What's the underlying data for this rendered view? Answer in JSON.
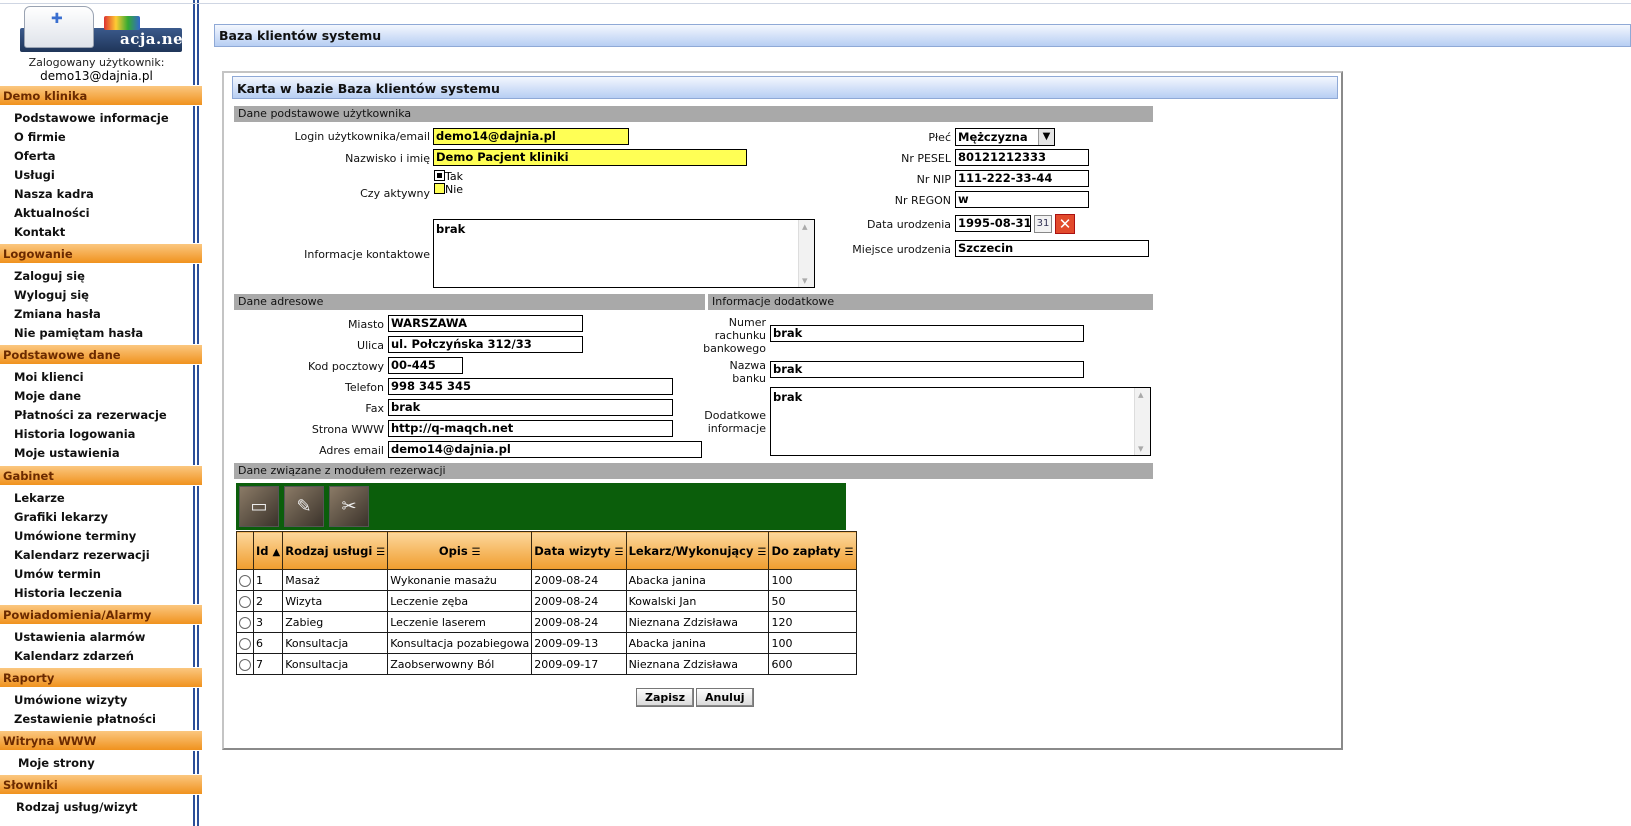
{
  "sidebar": {
    "logo_text": "acja.net",
    "user_label": "Zalogowany użytkownik:",
    "user_email": "demo13@dajnia.pl",
    "sections": [
      {
        "title": "Demo klinika",
        "items": [
          "Podstawowe informacje",
          "O firmie",
          "Oferta",
          "Usługi",
          "Nasza kadra",
          "Aktualności",
          "Kontakt"
        ]
      },
      {
        "title": "Logowanie",
        "items": [
          "Zaloguj się",
          "Wyloguj się",
          "Zmiana hasła",
          "Nie pamiętam hasła"
        ]
      },
      {
        "title": "Podstawowe dane",
        "items": [
          "Moi klienci",
          "Moje dane",
          "Płatności za rezerwacje",
          "Historia logowania",
          "Moje ustawienia"
        ]
      },
      {
        "title": "Gabinet",
        "items": [
          "Lekarze",
          "Grafiki lekarzy",
          "Umówione terminy",
          "Kalendarz rezerwacji",
          "Umów termin",
          "Historia leczenia"
        ]
      },
      {
        "title": "Powiadomienia/Alarmy",
        "items": [
          "Ustawienia alarmów",
          "Kalendarz zdarzeń"
        ]
      },
      {
        "title": "Raporty",
        "items": [
          "Umówione wizyty",
          "Zestawienie płatności"
        ]
      },
      {
        "title": "Witryna WWW",
        "items": [
          "Moje strony"
        ]
      },
      {
        "title": "Słowniki",
        "items": [
          "Rodzaj usług/wizyt"
        ]
      }
    ]
  },
  "main": {
    "title": "Baza klientów systemu",
    "card_title": "Karta w bazie Baza klientów systemu"
  },
  "basic": {
    "section_title": "Dane podstawowe użytkownika",
    "login_label": "Login użytkownika/email",
    "login_value": "demo14@dajnia.pl",
    "name_label": "Nazwisko i imię",
    "name_value": "Demo Pacjent kliniki",
    "active_label": "Czy aktywny",
    "active_yes": "Tak",
    "active_no": "Nie",
    "active_value": "Tak",
    "contact_label": "Informacje kontaktowe",
    "contact_value": "brak",
    "sex_label": "Płeć",
    "sex_value": "Mężczyzna",
    "pesel_label": "Nr PESEL",
    "pesel_value": "80121212333",
    "nip_label": "Nr NIP",
    "nip_value": "111-222-33-44",
    "regon_label": "Nr REGON",
    "regon_value": "w",
    "birthdate_label": "Data urodzenia",
    "birthdate_value": "1995-08-31",
    "birthplace_label": "Miejsce urodzenia",
    "birthplace_value": "Szczecin"
  },
  "address": {
    "section_title": "Dane adresowe",
    "city_label": "Miasto",
    "city_value": "WARSZAWA",
    "street_label": "Ulica",
    "street_value": "ul. Połczyńska 312/33",
    "zip_label": "Kod pocztowy",
    "zip_value": "00-445",
    "phone_label": "Telefon",
    "phone_value": "998 345 345",
    "fax_label": "Fax",
    "fax_value": "brak",
    "www_label": "Strona WWW",
    "www_value": "http://q-maqch.net",
    "email_label": "Adres email",
    "email_value": "demo14@dajnia.pl"
  },
  "extra": {
    "section_title": "Informacje dodatkowe",
    "account_label_1": "Numer",
    "account_label_2": "rachunku",
    "account_label_3": "bankowego",
    "account_value": "brak",
    "bank_label_1": "Nazwa",
    "bank_label_2": "banku",
    "bank_value": "brak",
    "notes_label_1": "Dodatkowe",
    "notes_label_2": "informacje",
    "notes_value": "brak"
  },
  "reservations": {
    "section_title": "Dane związane z modułem rezerwacji",
    "toolbar_icons": [
      "new-document-icon",
      "edit-pencil-icon",
      "delete-scissors-icon"
    ],
    "columns": [
      "Id",
      "Rodzaj usługi",
      "Opis",
      "Data wizyty",
      "Lekarz/Wykonujący",
      "Do zapłaty"
    ],
    "sort_column": "Id",
    "rows": [
      [
        "1",
        "Masaż",
        "Wykonanie masażu",
        "2009-08-24",
        "Abacka janina",
        "100"
      ],
      [
        "2",
        "Wizyta",
        "Leczenie zęba",
        "2009-08-24",
        "Kowalski Jan",
        "50"
      ],
      [
        "3",
        "Zabieg",
        "Leczenie laserem",
        "2009-08-24",
        "Nieznana Zdzisława",
        "120"
      ],
      [
        "6",
        "Konsultacja",
        "Konsultacja pozabiegowa",
        "2009-09-13",
        "Abacka janina",
        "100"
      ],
      [
        "7",
        "Konsultacja",
        "Zaobserwowny Ból",
        "2009-09-17",
        "Nieznana Zdzisława",
        "600"
      ]
    ]
  },
  "actions": {
    "save_label": "Zapisz",
    "cancel_label": "Anuluj"
  },
  "colors": {
    "section_orange": "#f0921e",
    "title_blue": "#b7cef3",
    "toolbar_green": "#0b5e0b",
    "highlight_yellow": "#ffff55"
  }
}
